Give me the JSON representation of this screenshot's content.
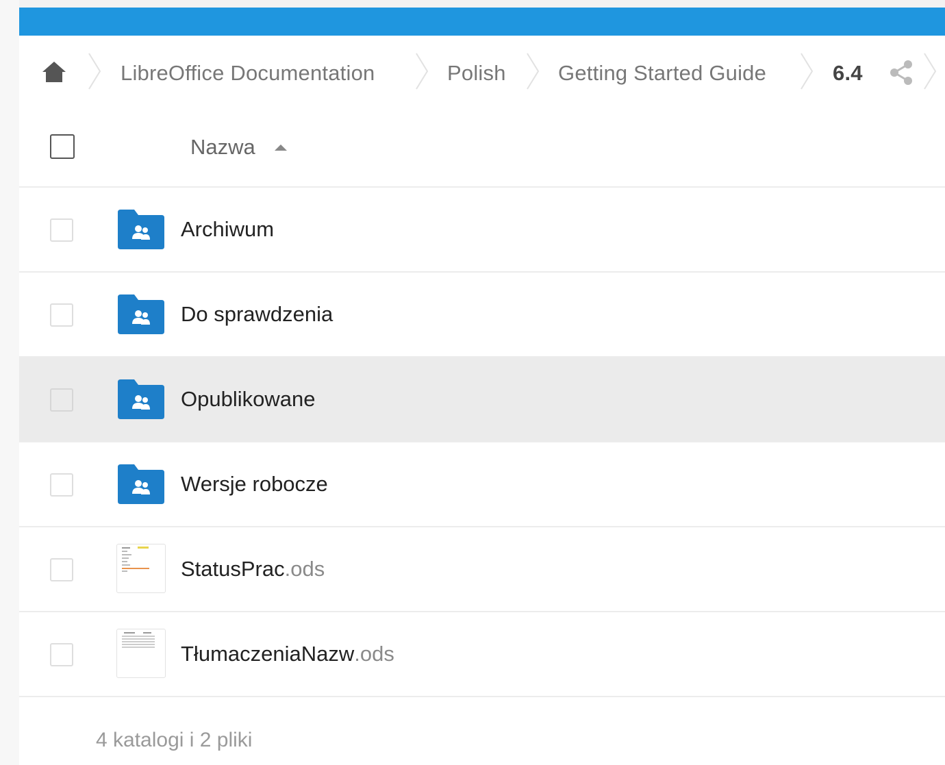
{
  "breadcrumb": {
    "home_icon": "home-icon",
    "items": [
      "LibreOffice Documentation",
      "Polish",
      "Getting Started Guide",
      "6.4"
    ],
    "share_icon": "share-icon"
  },
  "table": {
    "name_header": "Nazwa",
    "sort_direction": "ascending",
    "rows": [
      {
        "name": "Archiwum",
        "ext": "",
        "type": "shared-folder"
      },
      {
        "name": "Do sprawdzenia",
        "ext": "",
        "type": "shared-folder"
      },
      {
        "name": "Opublikowane",
        "ext": "",
        "type": "shared-folder",
        "hovered": true
      },
      {
        "name": "Wersje robocze",
        "ext": "",
        "type": "shared-folder"
      },
      {
        "name": "StatusPrac",
        "ext": ".ods",
        "type": "spreadsheet"
      },
      {
        "name": "TłumaczeniaNazw",
        "ext": ".ods",
        "type": "spreadsheet"
      }
    ]
  },
  "summary": "4 katalogi i 2 pliki",
  "colors": {
    "accent": "#1f96df",
    "folder": "#1e7fc9",
    "hover_row": "#ebebeb"
  }
}
